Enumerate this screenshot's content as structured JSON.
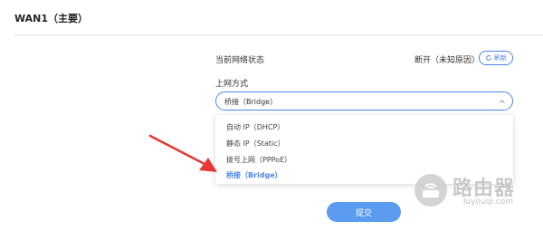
{
  "section": {
    "title": "WAN1（主要）"
  },
  "status": {
    "label": "当前网络状态",
    "value": "断开（未知原因）",
    "refresh_label": "刷新"
  },
  "connection_mode": {
    "label": "上网方式",
    "selected": "桥接（Bridge）",
    "options": [
      {
        "label": "自动 IP（DHCP）",
        "selected": false
      },
      {
        "label": "静态 IP（Static）",
        "selected": false
      },
      {
        "label": "拨号上网（PPPoE）",
        "selected": false
      },
      {
        "label": "桥接（Bridge）",
        "selected": true
      }
    ]
  },
  "submit_label": "提交",
  "watermark": {
    "title": "路由器",
    "subtitle": "luyouqi.com"
  },
  "colors": {
    "accent": "#4a86e8",
    "arrow": "#e53935",
    "button": "#5b9cf0"
  }
}
